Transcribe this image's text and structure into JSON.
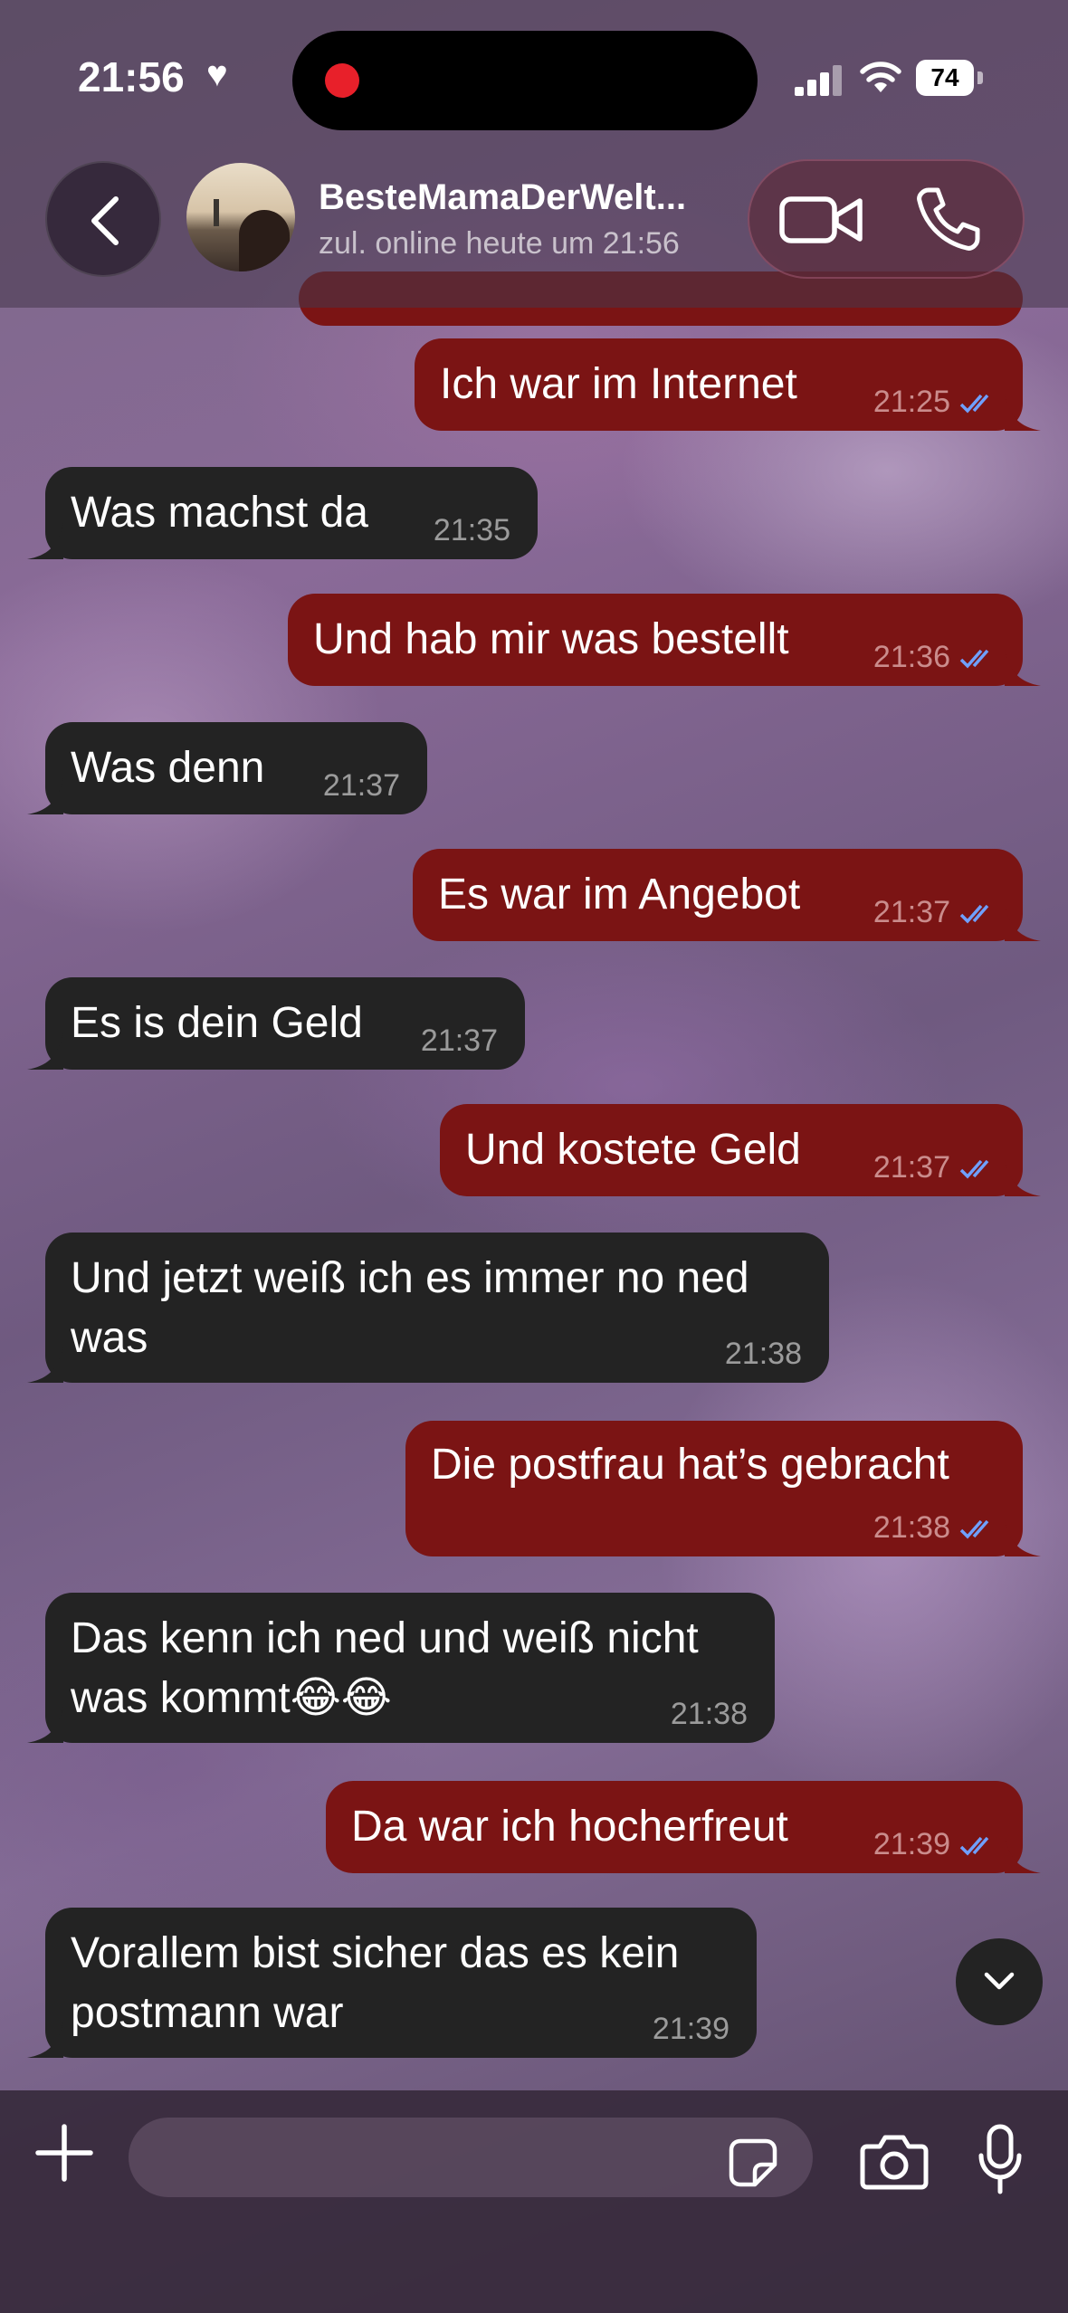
{
  "status_bar": {
    "time": "21:56",
    "battery": "74"
  },
  "header": {
    "contact_name": "BesteMamaDerWelt...",
    "contact_status": "zul. online heute um 21:56"
  },
  "messages": [
    {
      "dir": "out",
      "text": "Ich war im Internet",
      "time": "21:25"
    },
    {
      "dir": "in",
      "text": "Was machst da",
      "time": "21:35"
    },
    {
      "dir": "out",
      "text": "Und hab mir was bestellt",
      "time": "21:36"
    },
    {
      "dir": "in",
      "text": "Was denn",
      "time": "21:37"
    },
    {
      "dir": "out",
      "text": "Es war im Angebot",
      "time": "21:37"
    },
    {
      "dir": "in",
      "text": "Es is dein Geld",
      "time": "21:37"
    },
    {
      "dir": "out",
      "text": "Und kostete Geld",
      "time": "21:37"
    },
    {
      "dir": "in",
      "text": "Und jetzt weiß ich es immer no ned was",
      "time": "21:38"
    },
    {
      "dir": "out",
      "text": "Die postfrau hat’s gebracht",
      "time": "21:38"
    },
    {
      "dir": "in",
      "text": "Das kenn ich ned und weiß nicht was kommt😂😂",
      "time": "21:38"
    },
    {
      "dir": "out",
      "text": "Da war ich hocherfreut",
      "time": "21:39"
    },
    {
      "dir": "in",
      "text": "Vorallem bist sicher das es kein postmann war",
      "time": "21:39"
    }
  ],
  "input": {
    "placeholder": "",
    "value": ""
  },
  "colors": {
    "outgoing_bubble": "#7b1414",
    "incoming_bubble": "#232323",
    "read_ticks": "#6fa0ff"
  },
  "icons": [
    "heart-icon",
    "signal-icon",
    "wifi-icon",
    "battery-icon",
    "back-chevron-icon",
    "video-call-icon",
    "phone-icon",
    "chevron-down-icon",
    "plus-icon",
    "sticker-icon",
    "camera-icon",
    "microphone-icon"
  ]
}
